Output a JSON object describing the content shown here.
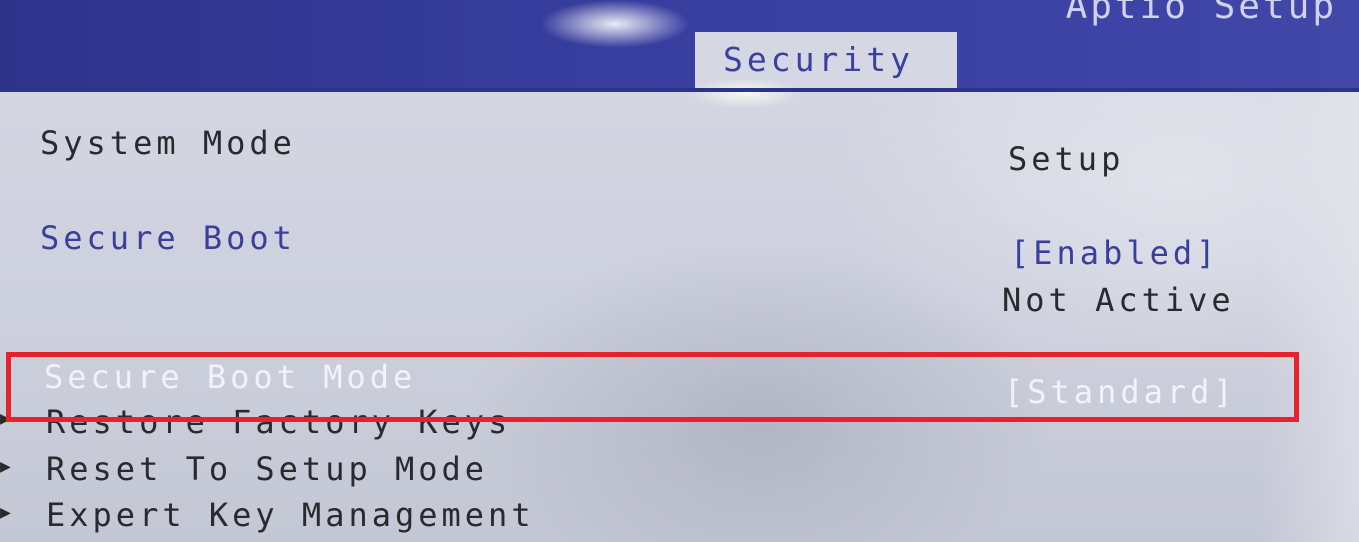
{
  "header": {
    "app_title": "Aptio Setup",
    "active_tab": "Security"
  },
  "settings": [
    {
      "label": "System Mode",
      "value": "Setup"
    },
    {
      "label": "Secure Boot",
      "value": "[Enabled]",
      "status": "Not Active"
    },
    {
      "label": "Secure Boot Mode",
      "value": "[Standard]"
    }
  ],
  "submenus": [
    {
      "label": "Restore Factory Keys"
    },
    {
      "label": "Reset To Setup Mode"
    },
    {
      "label": "Expert Key Management"
    }
  ],
  "colors": {
    "header_bg": "#3a41a3",
    "highlight_box": "#e8222c",
    "selectable_text": "#3a3f9e"
  }
}
